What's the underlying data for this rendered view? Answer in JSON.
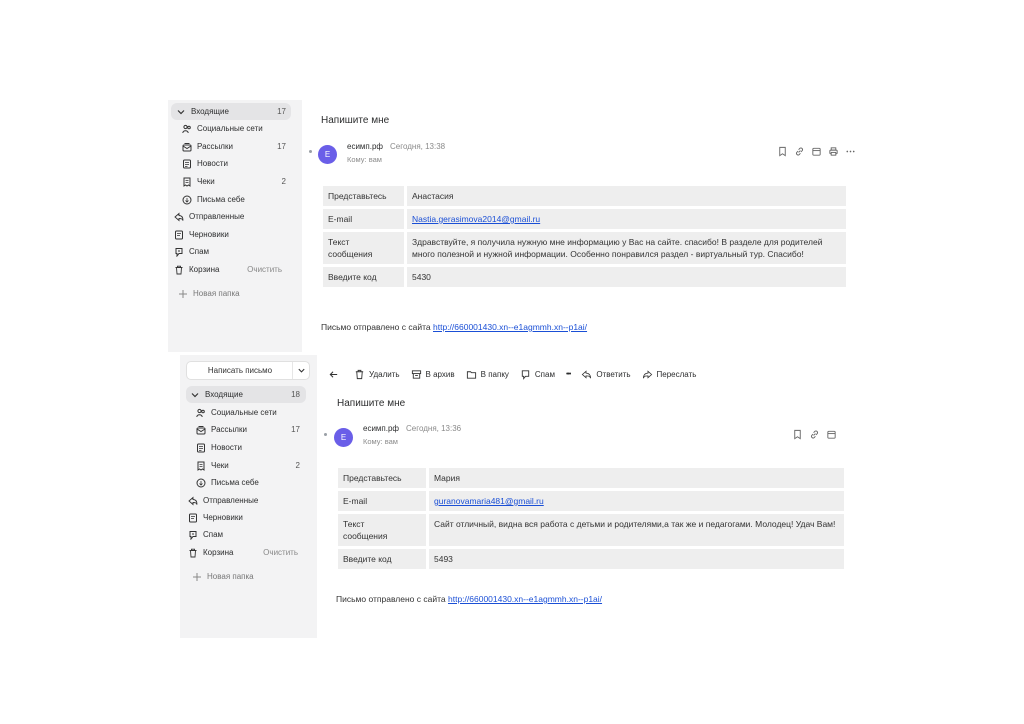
{
  "shot1": {
    "folders": [
      {
        "label": "Входящие",
        "count": "17"
      },
      {
        "label": "Социальные сети",
        "count": ""
      },
      {
        "label": "Рассылки",
        "count": "17"
      },
      {
        "label": "Новости",
        "count": ""
      },
      {
        "label": "Чеки",
        "count": "2"
      },
      {
        "label": "Письма себе",
        "count": ""
      },
      {
        "label": "Отправленные",
        "count": ""
      },
      {
        "label": "Черновики",
        "count": ""
      },
      {
        "label": "Спам",
        "count": ""
      },
      {
        "label": "Корзина",
        "count": ""
      }
    ],
    "clear_label": "Очистить",
    "new_folder": "Новая папка",
    "subject": "Напишите мне",
    "avatar_letter": "E",
    "sender": "есимп.рф",
    "date": "Сегодня, 13:38",
    "to": "Кому: вам",
    "form": {
      "name_key": "Представьтесь",
      "name_val": "Анастасия",
      "email_key": "E-mail",
      "email_val": "Nastia.gerasimova2014@gmail.ru",
      "text_key_1": "Текст",
      "text_key_2": "сообщения",
      "text_val": "Здравствуйте, я получила нужную мне информацию у Вас на сайте. спасибо! В разделе для родителей много полезной и нужной информации. Особенно понравился раздел - виртуальный тур. Спасибо!",
      "code_key": "Введите код",
      "code_val": "5430"
    },
    "footer_prefix": "Письмо отправлено с сайта",
    "footer_link": "http://660001430.xn--e1agmmh.xn--p1ai/"
  },
  "shot2": {
    "compose_label": "Написать письмо",
    "folders": [
      {
        "label": "Входящие",
        "count": "18"
      },
      {
        "label": "Социальные сети",
        "count": ""
      },
      {
        "label": "Рассылки",
        "count": "17"
      },
      {
        "label": "Новости",
        "count": ""
      },
      {
        "label": "Чеки",
        "count": "2"
      },
      {
        "label": "Письма себе",
        "count": ""
      },
      {
        "label": "Отправленные",
        "count": ""
      },
      {
        "label": "Черновики",
        "count": ""
      },
      {
        "label": "Спам",
        "count": ""
      },
      {
        "label": "Корзина",
        "count": ""
      }
    ],
    "clear_label": "Очистить",
    "new_folder": "Новая папка",
    "toolbar": {
      "delete": "Удалить",
      "archive": "В архив",
      "to_folder": "В папку",
      "spam": "Спам",
      "more": "•••",
      "reply": "Ответить",
      "forward": "Переслать"
    },
    "subject": "Напишите мне",
    "avatar_letter": "E",
    "sender": "есимп.рф",
    "date": "Сегодня, 13:36",
    "to": "Кому: вам",
    "form": {
      "name_key": "Представьтесь",
      "name_val": "Мария",
      "email_key": "E-mail",
      "email_val": "guranovamaria481@gmail.ru",
      "text_key_1": "Текст",
      "text_key_2": "сообщения",
      "text_val": "Сайт отличный, видна вся работа с детьми и родителями,а так же и педагогами. Молодец! Удач Вам!",
      "code_key": "Введите код",
      "code_val": "5493"
    },
    "footer_prefix": "Письмо отправлено с сайта",
    "footer_link": "http://660001430.xn--e1agmmh.xn--p1ai/"
  }
}
